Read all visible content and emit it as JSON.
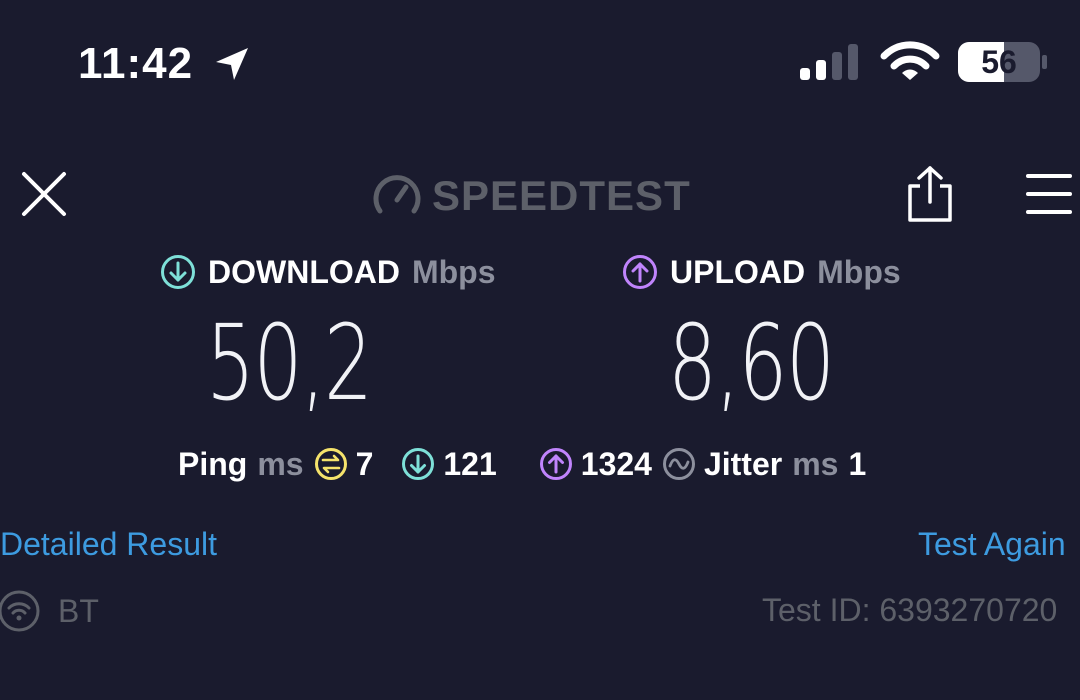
{
  "status_bar": {
    "time": "11:42",
    "battery_level": "56",
    "icons": [
      "location-arrow-icon",
      "cellular-signal-icon",
      "wifi-icon",
      "battery-icon"
    ]
  },
  "nav": {
    "logo_text": "SPEEDTEST",
    "icons": [
      "close-icon",
      "speedometer-icon",
      "share-icon",
      "menu-icon"
    ]
  },
  "download": {
    "label": "DOWNLOAD",
    "unit": "Mbps",
    "value": "50,2",
    "accent": "#7ee0d8"
  },
  "upload": {
    "label": "UPLOAD",
    "unit": "Mbps",
    "value": "8,60",
    "accent": "#c084fc"
  },
  "ping": {
    "label": "Ping",
    "unit": "ms",
    "idle": "7",
    "download": "121",
    "upload": "1324",
    "idle_color": "#f5e36b"
  },
  "jitter": {
    "label": "Jitter",
    "unit": "ms",
    "value": "1"
  },
  "links": {
    "detailed": "Detailed Result",
    "test_again": "Test Again"
  },
  "footer": {
    "provider": "BT",
    "test_id": "Test ID: 6393270720"
  }
}
